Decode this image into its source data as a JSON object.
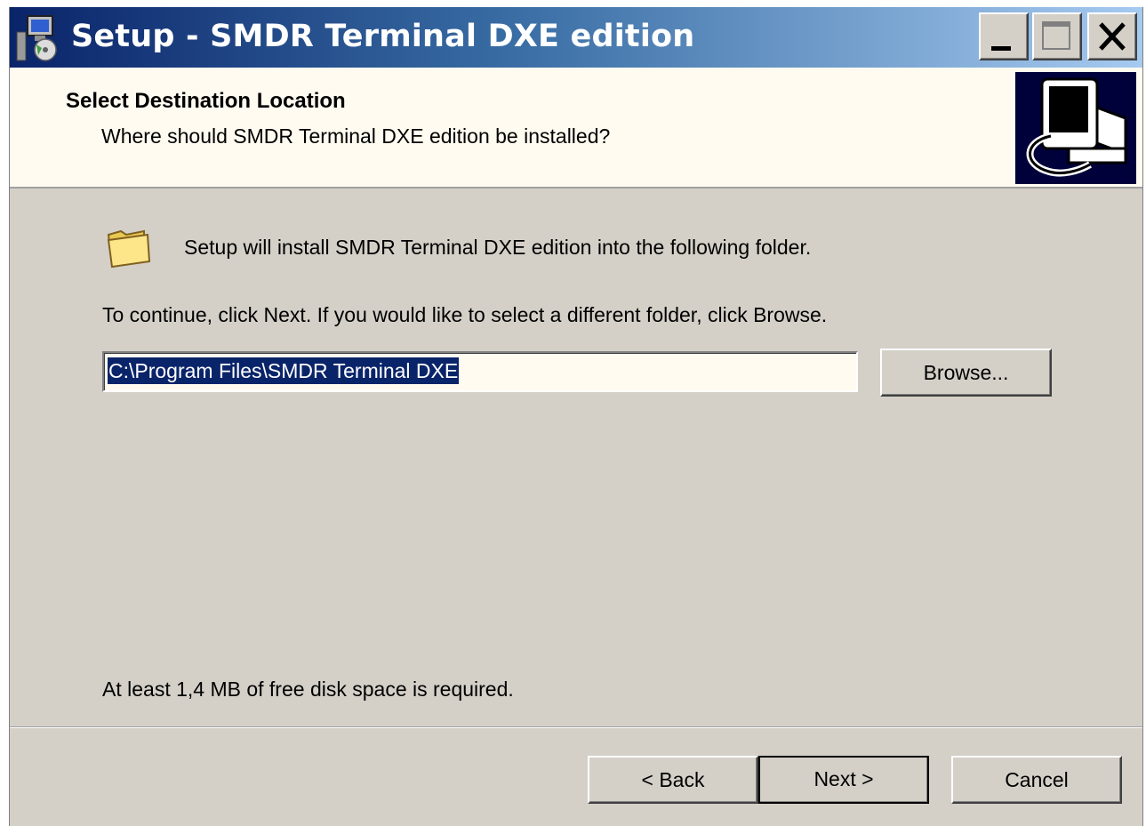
{
  "window": {
    "title": "Setup - SMDR Terminal DXE edition",
    "icons": {
      "app": "setup-installer-icon",
      "minimize": "minimize-icon",
      "maximize": "maximize-icon",
      "close": "close-icon"
    }
  },
  "header": {
    "title": "Select Destination Location",
    "subtitle": "Where should SMDR Terminal DXE edition be installed?",
    "image_icon": "computer-install-icon"
  },
  "body": {
    "folder_icon": "folder-icon",
    "intro": "Setup will install SMDR Terminal DXE edition into the following folder.",
    "instructions": "To continue, click Next. If you would like to select a different folder, click Browse.",
    "path_value": "C:\\Program Files\\SMDR Terminal DXE",
    "browse_label": "Browse...",
    "disk_space": "At least 1,4 MB of free disk space is required."
  },
  "footer": {
    "back_label": "< Back",
    "next_label": "Next >",
    "cancel_label": "Cancel"
  },
  "colors": {
    "dialog_bg": "#d4d0c8",
    "header_bg": "#fffbf0",
    "title_gradient_start": "#0a246a",
    "title_gradient_end": "#a6caf0",
    "selection": "#0a246a"
  }
}
